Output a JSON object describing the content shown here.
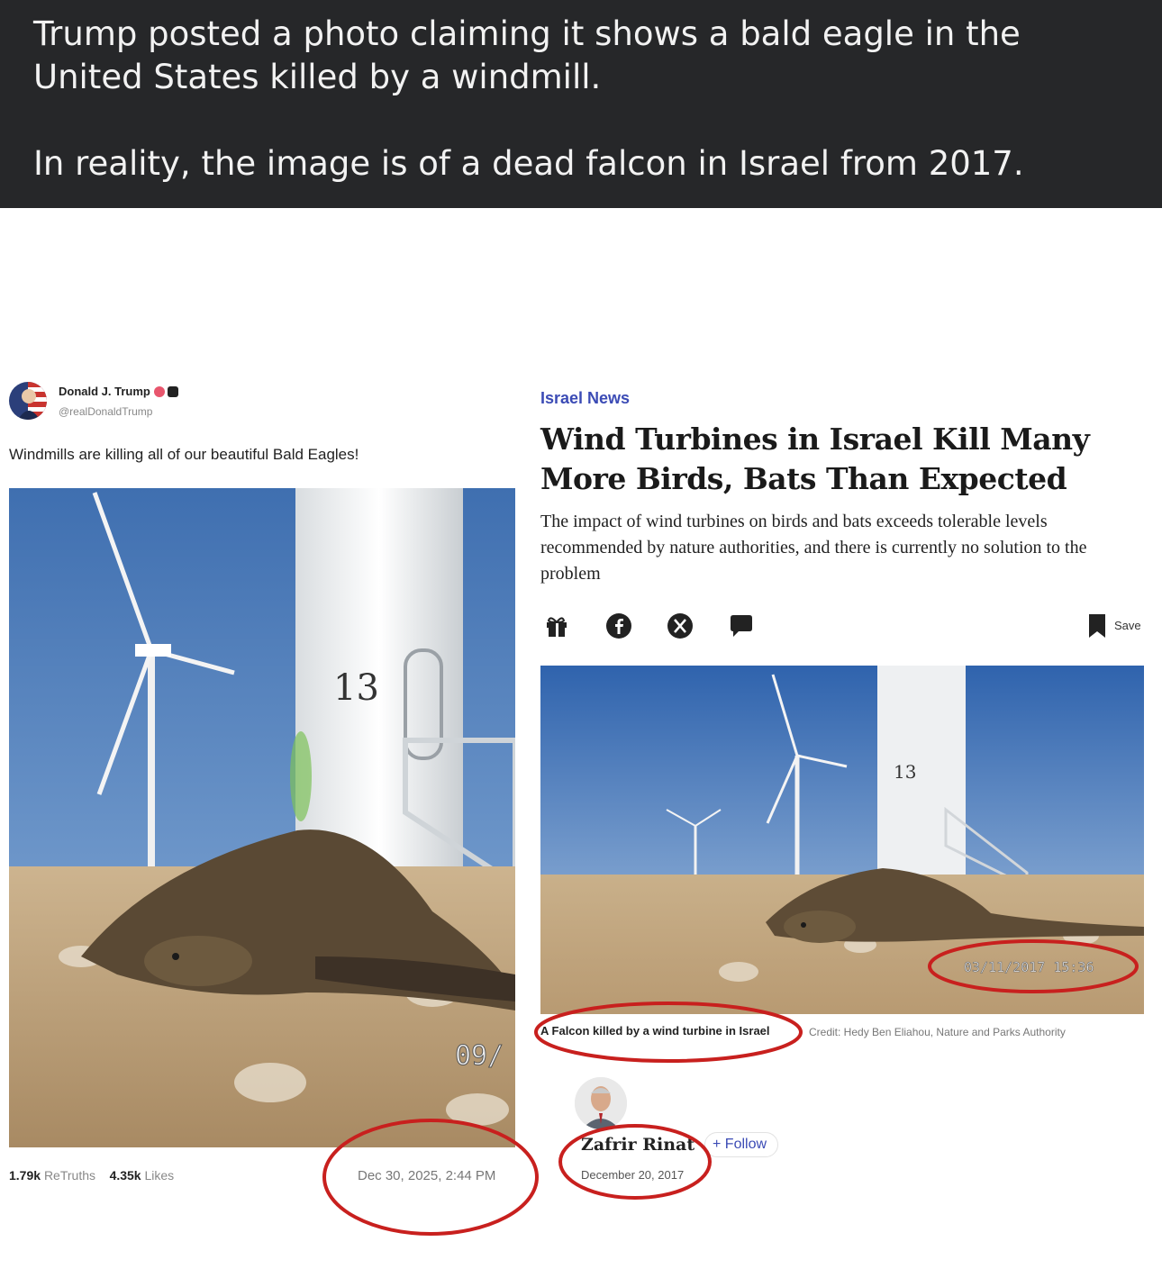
{
  "caption": {
    "line1": "Trump posted a photo claiming it shows a bald eagle in the United States killed by a windmill.",
    "line2": "In reality, the image is of a dead falcon in Israel from 2017."
  },
  "truth_post": {
    "author": "Donald J. Trump",
    "handle": "@realDonaldTrump",
    "text": "Windmills are killing all of our beautiful Bald Eagles!",
    "image_tower_number": "13",
    "image_stamp": "09/",
    "retruths_count": "1.79k",
    "retruths_label": "ReTruths",
    "likes_count": "4.35k",
    "likes_label": "Likes",
    "date": "Dec 30, 2025, 2:44 PM"
  },
  "article": {
    "section": "Israel News",
    "headline": "Wind Turbines in Israel Kill Many More Birds, Bats Than Expected",
    "dek": "The impact of wind turbines on birds and bats exceeds tolerable levels recommended by nature authorities, and there is currently no solution to the problem",
    "save_label": "Save",
    "share_icons": [
      "gift-icon",
      "facebook-icon",
      "x-icon",
      "comment-icon"
    ],
    "image_tower_number": "13",
    "image_timestamp": "03/11/2017 15:36",
    "image_caption": "A Falcon killed by a wind turbine in Israel",
    "image_credit": "Credit: Hedy Ben Eliahou, Nature and Parks Authority",
    "writer_name": "Zafrir Rinat",
    "follow_label": "Follow",
    "writer_date": "December 20, 2017"
  },
  "colors": {
    "caption_bg": "#262729",
    "annotation_red": "#c8201e",
    "link_blue": "#3b4bb5"
  }
}
